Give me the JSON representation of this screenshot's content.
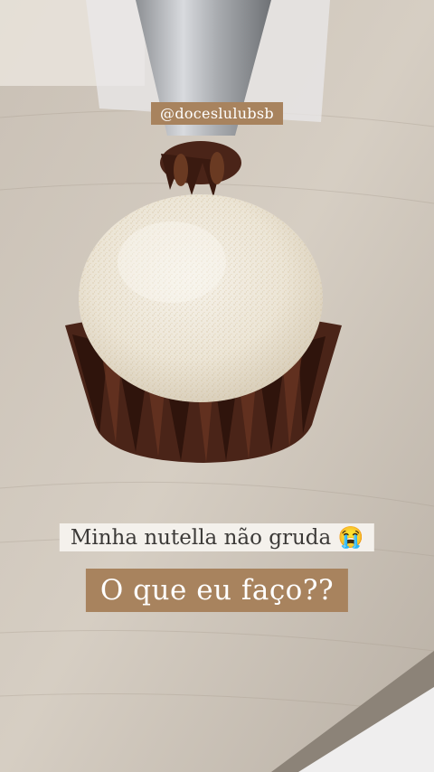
{
  "overlay": {
    "handle": "@doceslulubsb",
    "line1": "Minha nutella não gruda",
    "line1_emoji": "😭",
    "line2": "O que eu faço??"
  },
  "colors": {
    "caption_brown": "#a8835e",
    "caption_white": "#f4f1ec",
    "coconut": "#efe9dc",
    "chocolate": "#4a2418",
    "counter": "#d2cabf"
  },
  "image": {
    "subject": "coconut-covered brigadeiro in brown paper cup, chocolate being piped from a metal nozzle"
  }
}
